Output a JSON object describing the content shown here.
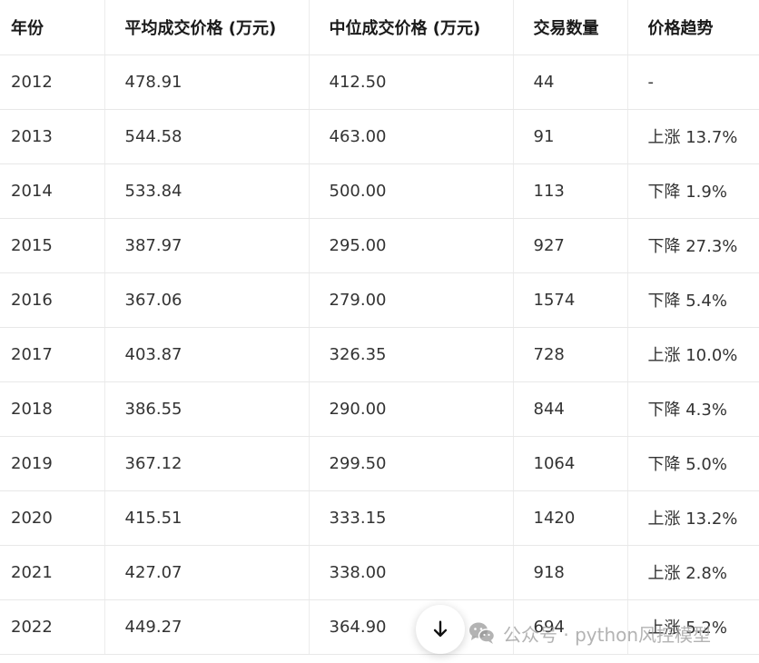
{
  "table": {
    "headers": [
      "年份",
      "平均成交价格 (万元)",
      "中位成交价格 (万元)",
      "交易数量",
      "价格趋势"
    ],
    "rows": [
      [
        "2012",
        "478.91",
        "412.50",
        "44",
        "-"
      ],
      [
        "2013",
        "544.58",
        "463.00",
        "91",
        "上涨 13.7%"
      ],
      [
        "2014",
        "533.84",
        "500.00",
        "113",
        "下降 1.9%"
      ],
      [
        "2015",
        "387.97",
        "295.00",
        "927",
        "下降 27.3%"
      ],
      [
        "2016",
        "367.06",
        "279.00",
        "1574",
        "下降 5.4%"
      ],
      [
        "2017",
        "403.87",
        "326.35",
        "728",
        "上涨 10.0%"
      ],
      [
        "2018",
        "386.55",
        "290.00",
        "844",
        "下降 4.3%"
      ],
      [
        "2019",
        "367.12",
        "299.50",
        "1064",
        "下降 5.0%"
      ],
      [
        "2020",
        "415.51",
        "333.15",
        "1420",
        "上涨 13.2%"
      ],
      [
        "2021",
        "427.07",
        "338.00",
        "918",
        "上涨 2.8%"
      ],
      [
        "2022",
        "449.27",
        "364.90",
        "694",
        "上涨 5.2%"
      ]
    ]
  },
  "scroll_button": {
    "icon": "arrow-down-icon"
  },
  "watermark": {
    "text": "公众号 · python风控模型",
    "icon": "wechat-icon"
  },
  "colors": {
    "text": "#333333",
    "header_text": "#1a1a1a",
    "grid_line": "#e8e8e8",
    "watermark": "#969696"
  }
}
